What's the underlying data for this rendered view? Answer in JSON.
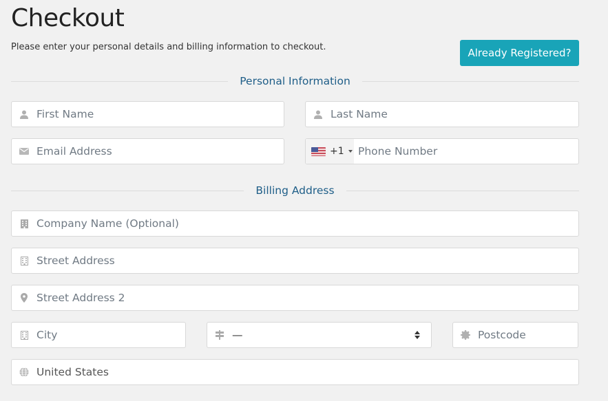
{
  "header": {
    "title": "Checkout",
    "subtitle": "Please enter your personal details and billing information to checkout.",
    "already_registered_label": "Already Registered?"
  },
  "colors": {
    "accent": "#19a4b8",
    "section_heading": "#1f5e88",
    "background": "#f1f1f1"
  },
  "personal": {
    "heading": "Personal Information",
    "first_name": {
      "placeholder": "First Name",
      "value": "",
      "icon": "user-icon"
    },
    "last_name": {
      "placeholder": "Last Name",
      "value": "",
      "icon": "user-icon"
    },
    "email": {
      "placeholder": "Email Address",
      "value": "",
      "icon": "envelope-icon"
    },
    "phone": {
      "placeholder": "Phone Number",
      "value": "",
      "country_flag": "us-flag-icon",
      "dial_code": "+1"
    }
  },
  "billing": {
    "heading": "Billing Address",
    "company": {
      "placeholder": "Company Name (Optional)",
      "value": "",
      "icon": "building-icon"
    },
    "street": {
      "placeholder": "Street Address",
      "value": "",
      "icon": "building-outline-icon"
    },
    "street2": {
      "placeholder": "Street Address 2",
      "value": "",
      "icon": "map-marker-icon"
    },
    "city": {
      "placeholder": "City",
      "value": "",
      "icon": "building-outline-icon"
    },
    "state": {
      "selected": "—",
      "icon": "signpost-icon"
    },
    "postcode": {
      "placeholder": "Postcode",
      "value": "",
      "icon": "certificate-icon"
    },
    "country": {
      "selected": "United States",
      "icon": "globe-icon"
    }
  }
}
